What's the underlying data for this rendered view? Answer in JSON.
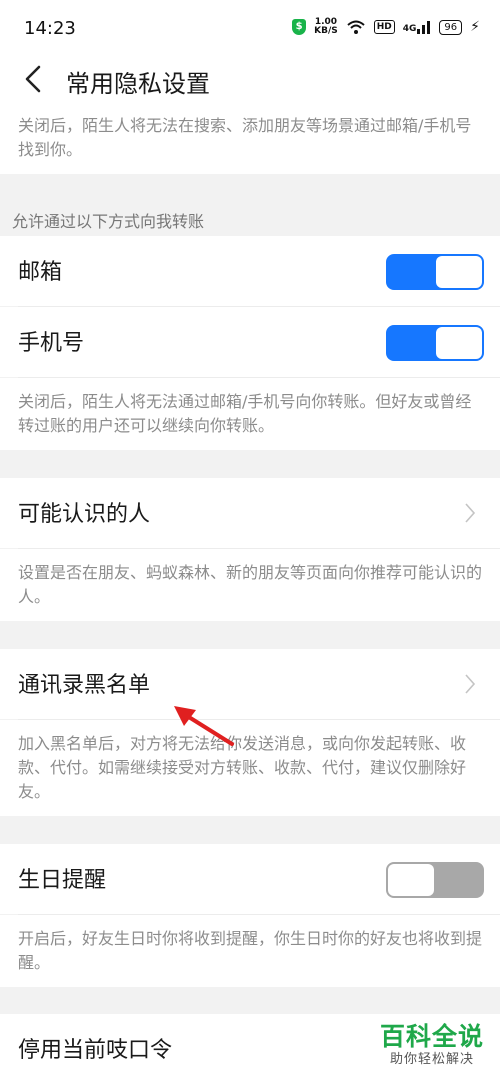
{
  "status_bar": {
    "time": "14:23",
    "net_speed_value": "1.00",
    "net_speed_unit": "KB/S",
    "hd": "HD",
    "signal": "4G",
    "battery": "96"
  },
  "header": {
    "title": "常用隐私设置"
  },
  "sections": {
    "search_desc": "关闭后，陌生人将无法在搜索、添加朋友等场景通过邮箱/手机号找到你。",
    "transfer_label": "允许通过以下方式向我转账",
    "email": {
      "label": "邮箱",
      "enabled": true
    },
    "phone": {
      "label": "手机号",
      "enabled": true
    },
    "transfer_desc": "关闭后，陌生人将无法通过邮箱/手机号向你转账。但好友或曾经转过账的用户还可以继续向你转账。",
    "people_you_may_know": {
      "label": "可能认识的人"
    },
    "people_desc": "设置是否在朋友、蚂蚁森林、新的朋友等页面向你推荐可能认识的人。",
    "blacklist": {
      "label": "通讯录黑名单"
    },
    "blacklist_desc": "加入黑名单后，对方将无法给你发送消息，或向你发起转账、收款、代付。如需继续接受对方转账、收款、代付，建议仅删除好友。",
    "birthday": {
      "label": "生日提醒",
      "enabled": false
    },
    "birthday_desc": "开启后，好友生日时你将收到提醒，你生日时你的好友也将收到提醒。",
    "disable_code": {
      "label": "停用当前吱口令"
    }
  },
  "watermark": {
    "title": "百科全说",
    "subtitle": "助你轻松解决"
  },
  "colors": {
    "toggle_on": "#1677ff",
    "toggle_off": "#a8a8a8",
    "watermark": "#1fa84a",
    "annotation_arrow": "#e02020"
  }
}
